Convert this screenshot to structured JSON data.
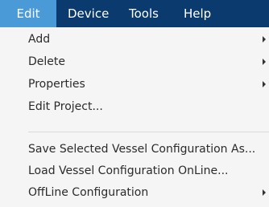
{
  "menubar": {
    "items": [
      {
        "label": "Edit",
        "active": true
      },
      {
        "label": "Device"
      },
      {
        "label": "Tools"
      },
      {
        "label": "Help"
      }
    ]
  },
  "menu": {
    "items": [
      {
        "label": "Add",
        "has_submenu": true
      },
      {
        "label": "Delete",
        "has_submenu": true
      },
      {
        "label": "Properties",
        "has_submenu": true
      },
      {
        "label": "Edit Project..."
      },
      {
        "label": "Save Selected Vessel Configuration As..."
      },
      {
        "label": "Load Vessel Configuration OnLine..."
      },
      {
        "label": "OffLine Configuration",
        "has_submenu": true
      }
    ]
  },
  "colors": {
    "menubar_bg": "#0a3a6e",
    "active_tab_bg": "#4a9ad8",
    "menu_bg": "#f5f5f5",
    "text": "#2b2b2b"
  },
  "icons": {
    "submenu_arrow": "chevron-right-icon"
  }
}
